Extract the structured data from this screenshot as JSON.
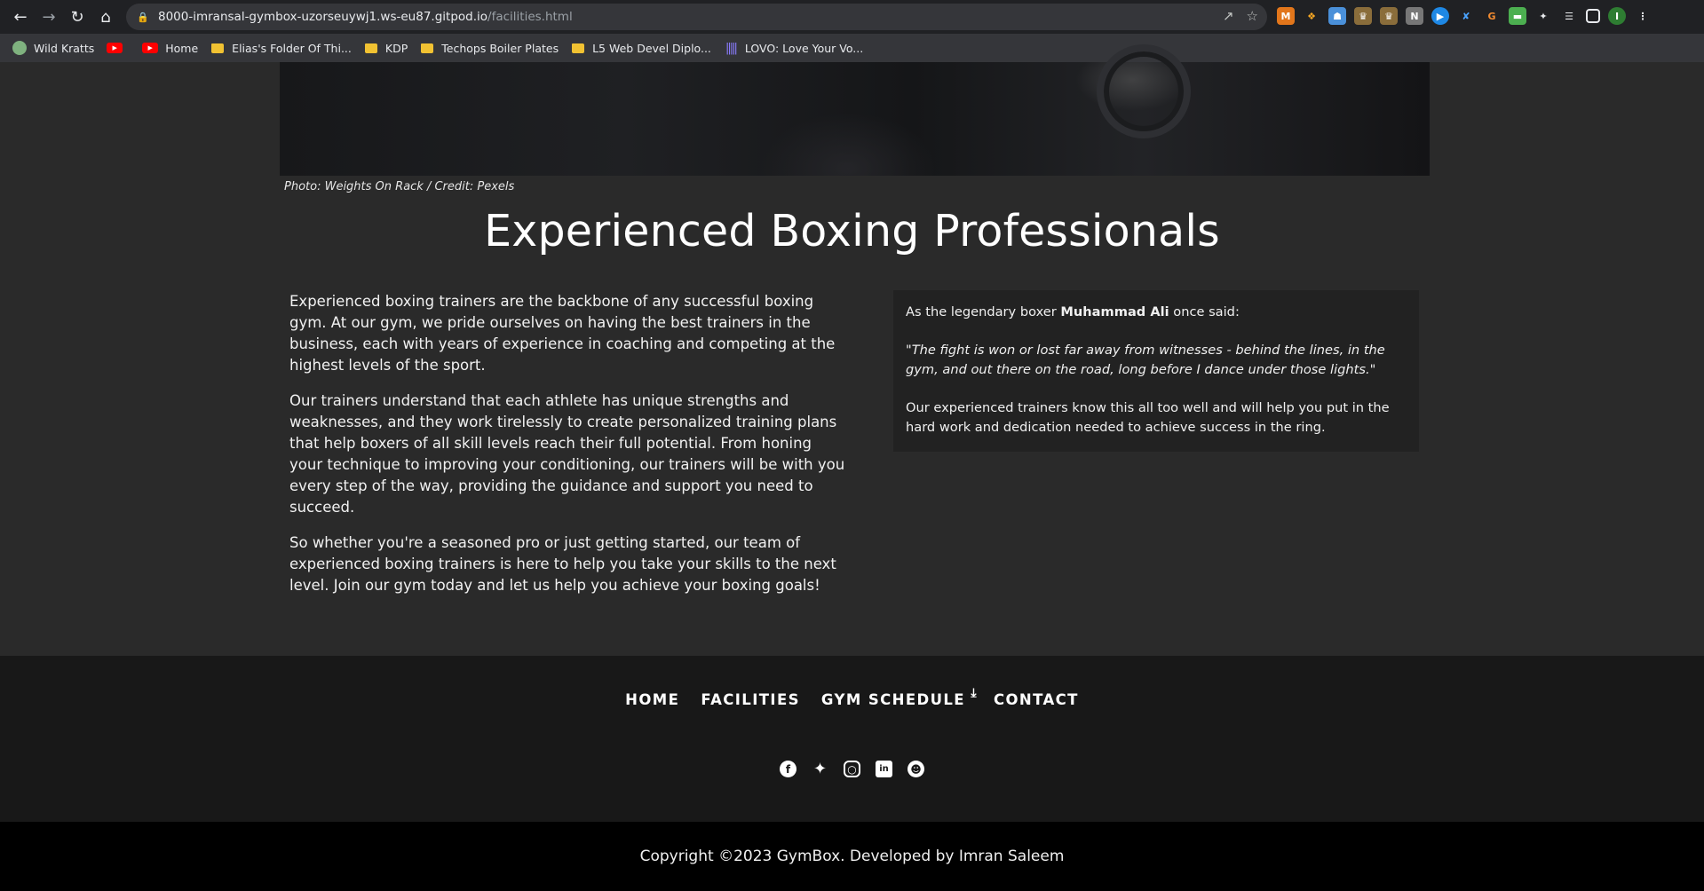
{
  "browser": {
    "url_host": "8000-imransal-gymbox-uzorseuywj1.ws-eu87.gitpod.io",
    "url_path": "/facilities.html",
    "bookmarks": [
      {
        "label": "Wild Kratts",
        "icon": "globe-icon"
      },
      {
        "label": "",
        "icon": "youtube-icon"
      },
      {
        "label": "Home",
        "icon": "youtube-icon"
      },
      {
        "label": "Elias's Folder Of Thi...",
        "icon": "folder-icon"
      },
      {
        "label": "KDP",
        "icon": "folder-icon"
      },
      {
        "label": "Techops Boiler Plates",
        "icon": "folder-icon"
      },
      {
        "label": "L5 Web Devel Diplo...",
        "icon": "folder-icon"
      },
      {
        "label": "LOVO: Love Your Vo...",
        "icon": "audio-wave-icon"
      }
    ]
  },
  "hero": {
    "caption": "Photo: Weights On Rack / Credit: Pexels"
  },
  "section": {
    "title": "Experienced Boxing Professionals",
    "paragraphs": [
      "Experienced boxing trainers are the backbone of any successful boxing gym. At our gym, we pride ourselves on having the best trainers in the business, each with years of experience in coaching and competing at the highest levels of the sport.",
      "Our trainers understand that each athlete has unique strengths and weaknesses, and they work tirelessly to create personalized training plans that help boxers of all skill levels reach their full potential. From honing your technique to improving your conditioning, our trainers will be with you every step of the way, providing the guidance and support you need to succeed.",
      "So whether you're a seasoned pro or just getting started, our team of experienced boxing trainers is here to help you take your skills to the next level. Join our gym today and let us help you achieve your boxing goals!"
    ]
  },
  "quote_box": {
    "intro_before": "As the legendary boxer ",
    "intro_name": "Muhammad Ali",
    "intro_after": " once said:",
    "quote": "\"The fight is won or lost far away from witnesses - behind the lines, in the gym, and out there on the road, long before I dance under those lights.\"",
    "closing": "Our experienced trainers know this all too well and will help you put in the hard work and dedication needed to achieve success in the ring."
  },
  "footer": {
    "nav": [
      "HOME",
      "FACILITIES",
      "GYM SCHEDULE",
      "CONTACT"
    ],
    "social_icons": [
      "facebook-icon",
      "twitter-icon",
      "instagram-icon",
      "linkedin-icon",
      "github-icon"
    ],
    "copyright": "Copyright ©2023 GymBox. Developed by Imran Saleem"
  }
}
